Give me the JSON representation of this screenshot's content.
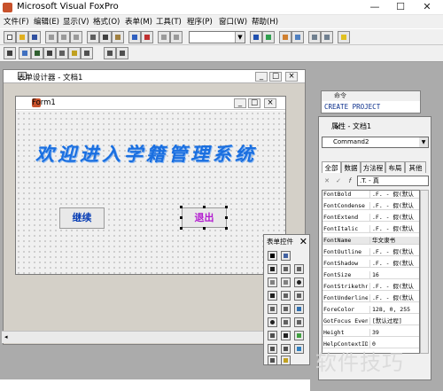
{
  "app": {
    "title": "Microsoft Visual FoxPro",
    "controls": {
      "minimize": "—",
      "maximize": "☐",
      "close": "✕"
    }
  },
  "menu": [
    "文件(F)",
    "编辑(E)",
    "显示(V)",
    "格式(O)",
    "表单(M)",
    "工具(T)",
    "程序(P)",
    "窗口(W)",
    "帮助(H)"
  ],
  "designer": {
    "title": "表单设计器 - 文档1",
    "form": {
      "title": "Form1",
      "heading": "欢迎进入学籍管理系统",
      "buttons": {
        "continue": "继续",
        "exit": "退出"
      }
    }
  },
  "command_window": {
    "title": "命令",
    "text": "CREATE PROJECT"
  },
  "properties": {
    "title": "属性 - 文档1",
    "object": "Command2",
    "tabs": [
      "全部",
      "数据",
      "方法程",
      "布局",
      "其他"
    ],
    "edit_value": ".T. - 真",
    "rows": [
      {
        "name": "FontBold",
        "value": ".F. - 假(默认"
      },
      {
        "name": "FontCondense",
        "value": ".F. - 假(默认"
      },
      {
        "name": "FontExtend",
        "value": ".F. - 假(默认"
      },
      {
        "name": "FontItalic",
        "value": ".F. - 假(默认"
      },
      {
        "name": "FontName",
        "value": "华文隶书"
      },
      {
        "name": "FontOutline",
        "value": ".F. - 假(默认"
      },
      {
        "name": "FontShadow",
        "value": ".F. - 假(默认"
      },
      {
        "name": "FontSize",
        "value": "16"
      },
      {
        "name": "FontStrikethr",
        "value": ".F. - 假(默认"
      },
      {
        "name": "FontUnderline",
        "value": ".F. - 假(默认"
      },
      {
        "name": "ForeColor",
        "value": "128, 0, 255"
      },
      {
        "name": "GotFocus Event",
        "value": "[默认过程]"
      },
      {
        "name": "Height",
        "value": "39"
      },
      {
        "name": "HelpContextID",
        "value": "0"
      }
    ]
  },
  "toolbox": {
    "title": "表单控件",
    "close": "✕"
  },
  "watermark": "软件技巧",
  "colors": {
    "heading": "#1a6fe0",
    "continue_text": "#0a3fb5",
    "exit_text": "#b21ad0"
  }
}
